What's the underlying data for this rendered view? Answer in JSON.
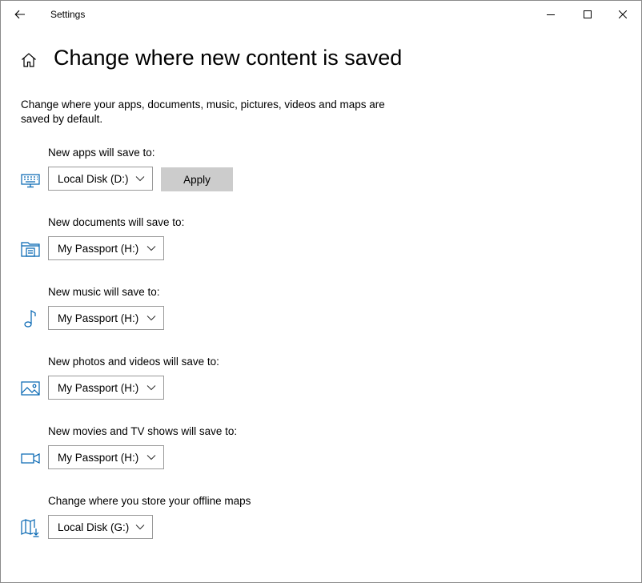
{
  "window": {
    "title": "Settings"
  },
  "icons": {
    "back": "back-arrow-icon",
    "minimize": "minimize-icon",
    "maximize": "maximize-icon",
    "close": "close-icon",
    "home": "home-icon"
  },
  "page": {
    "title": "Change where new content is saved",
    "description": "Change where your apps, documents, music, pictures, videos and maps are saved by default."
  },
  "rows": [
    {
      "label": "New apps will save to:",
      "value": "Local Disk (D:)",
      "icon": "monitor-keyboard-icon"
    },
    {
      "label": "New documents will save to:",
      "value": "My Passport (H:)",
      "icon": "folder-printer-icon"
    },
    {
      "label": "New music will save to:",
      "value": "My Passport (H:)",
      "icon": "music-note-icon"
    },
    {
      "label": "New photos and videos will save to:",
      "value": "My Passport (H:)",
      "icon": "photo-icon"
    },
    {
      "label": "New movies and TV shows will save to:",
      "value": "My Passport (H:)",
      "icon": "video-camera-icon"
    },
    {
      "label": "Change where you store your offline maps",
      "value": "Local Disk (G:)",
      "icon": "map-download-icon"
    }
  ],
  "apply_button": {
    "label": "Apply"
  },
  "colors": {
    "accent": "#0063b1",
    "button_bg": "#cccccc",
    "border": "#999999"
  }
}
